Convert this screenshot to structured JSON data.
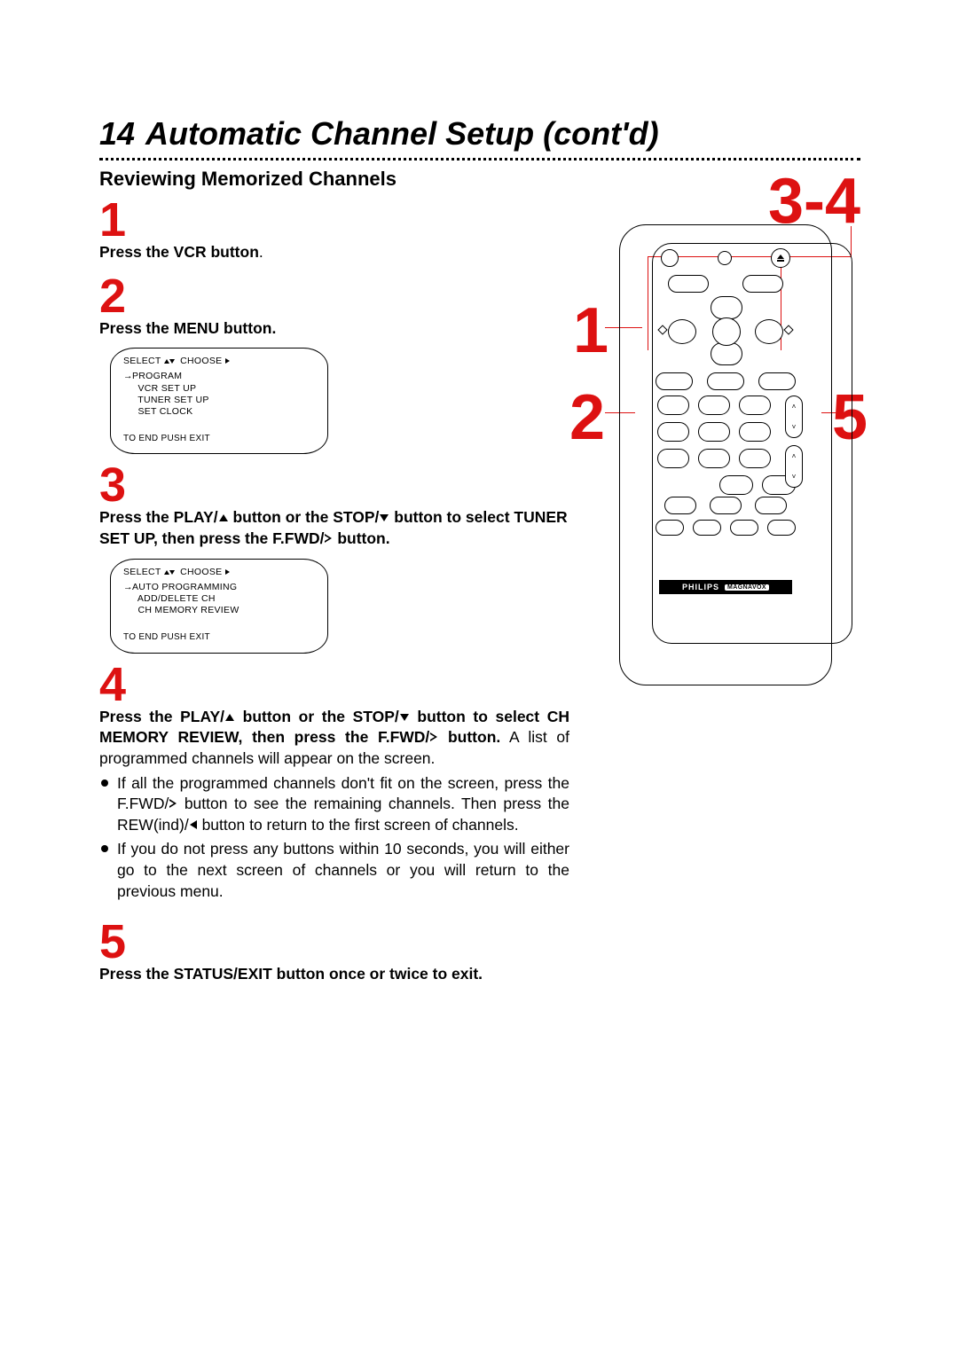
{
  "header": {
    "page_number": "14",
    "title": "Automatic Channel Setup (cont'd)"
  },
  "subheading": "Reviewing Memorized Channels",
  "right_step_label": "3-4",
  "callout_labels": {
    "one": "1",
    "two": "2",
    "five": "5"
  },
  "steps": {
    "s1": {
      "num": "1",
      "text_bold": "Press the VCR button",
      "text_after_bold": "."
    },
    "s2": {
      "num": "2",
      "text_bold": "Press the MENU button."
    },
    "s3": {
      "num": "3",
      "part_a": "Press the PLAY/",
      "part_b": " button or the STOP/",
      "part_c": " button to select TUNER SET UP, then press the F.FWD/",
      "part_d": " button."
    },
    "s4": {
      "num": "4",
      "bold_a": "Press the PLAY/",
      "bold_b": " button or the STOP/",
      "bold_c": " button to select CH MEMORY REVIEW, then press the F.FWD/",
      "bold_d": " button.",
      "plain_after": " A list of programmed channels will appear on the screen.",
      "bullets": [
        {
          "a": "If all the programmed channels don't fit on the screen, press the F.FWD/",
          "b": " button to see the remaining channels. Then press the REW(ind)/",
          "c": " button to return to the first screen of channels."
        },
        {
          "a": "If you do not press any buttons within 10 seconds, you will either go to the next screen of channels or you will return to the previous menu."
        }
      ]
    },
    "s5": {
      "num": "5",
      "text_bold": "Press the STATUS/EXIT button once or twice to exit."
    }
  },
  "osd1": {
    "select": "SELECT",
    "choose": "CHOOSE",
    "items": [
      "PROGRAM",
      "VCR SET UP",
      "TUNER SET UP",
      "SET CLOCK"
    ],
    "footer": "TO END PUSH EXIT"
  },
  "osd2": {
    "select": "SELECT",
    "choose": "CHOOSE",
    "items": [
      "AUTO PROGRAMMING",
      "ADD/DELETE CH",
      "CH MEMORY REVIEW"
    ],
    "footer": "TO END PUSH EXIT"
  },
  "remote": {
    "brand": "PHILIPS",
    "subbrand": "MAGNAVOX"
  }
}
